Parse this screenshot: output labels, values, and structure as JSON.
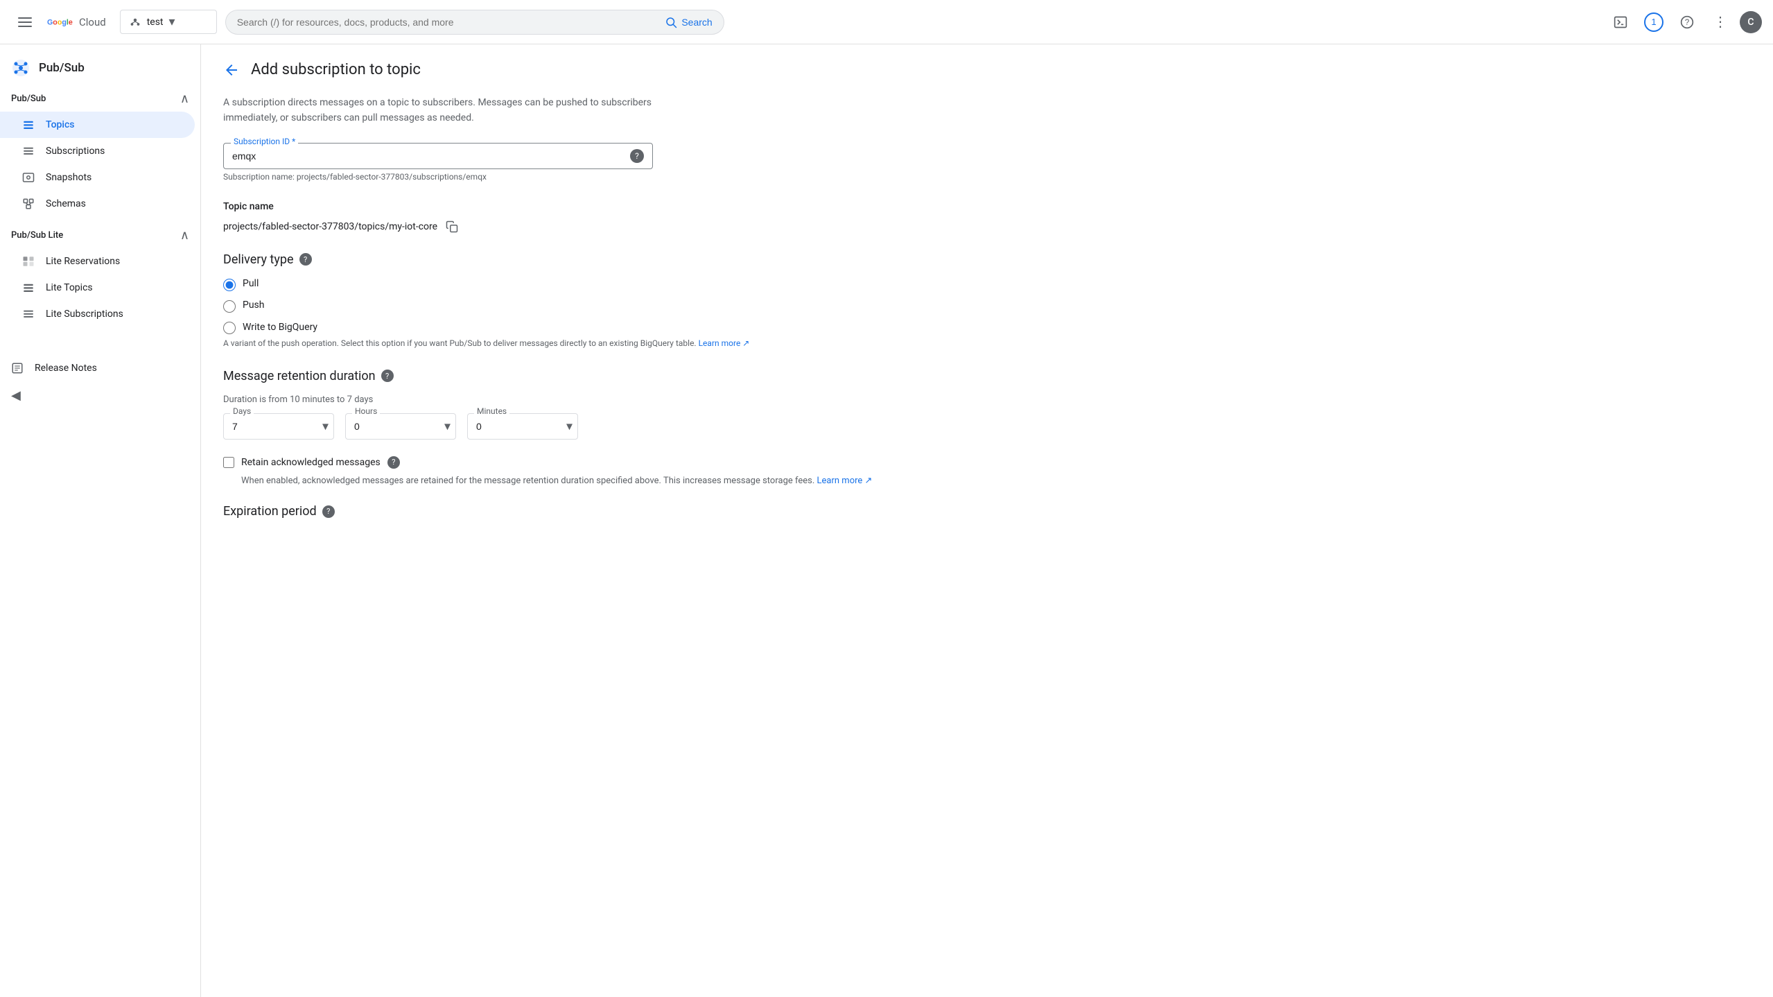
{
  "topbar": {
    "hamburger_label": "Menu",
    "logo_g": "G",
    "logo_cloud": "Cloud",
    "project_name": "test",
    "search_placeholder": "Search (/) for resources, docs, products, and more",
    "search_label": "Search",
    "notification_count": "1",
    "avatar_letter": "C"
  },
  "sidebar": {
    "service_title": "Pub/Sub",
    "pubsub_section": "Pub/Sub",
    "pubsub_lite_section": "Pub/Sub Lite",
    "items": [
      {
        "label": "Topics",
        "icon": "list-icon",
        "active": true
      },
      {
        "label": "Subscriptions",
        "icon": "list-rows-icon",
        "active": false
      },
      {
        "label": "Snapshots",
        "icon": "snapshot-icon",
        "active": false
      },
      {
        "label": "Schemas",
        "icon": "schema-icon",
        "active": false
      }
    ],
    "lite_items": [
      {
        "label": "Lite Reservations",
        "icon": "lite-res-icon",
        "active": false
      },
      {
        "label": "Lite Topics",
        "icon": "lite-topics-icon",
        "active": false
      },
      {
        "label": "Lite Subscriptions",
        "icon": "lite-sub-icon",
        "active": false
      }
    ],
    "release_notes": "Release Notes",
    "collapse_label": "Collapse"
  },
  "page": {
    "back_label": "Back",
    "title": "Add subscription to topic",
    "description": "A subscription directs messages on a topic to subscribers. Messages can be pushed to subscribers immediately, or subscribers can pull messages as needed.",
    "subscription_id_label": "Subscription ID *",
    "subscription_id_value": "emqx",
    "subscription_name_hint": "Subscription name: projects/fabled-sector-377803/subscriptions/emqx",
    "topic_name_label": "Topic name",
    "topic_name_value": "projects/fabled-sector-377803/topics/my-iot-core",
    "delivery_type_label": "Delivery type",
    "delivery_options": [
      {
        "label": "Pull",
        "checked": true
      },
      {
        "label": "Push",
        "checked": false
      },
      {
        "label": "Write to BigQuery",
        "checked": false
      }
    ],
    "write_bigquery_desc": "A variant of the push operation. Select this option if you want Pub/Sub to deliver messages directly to an existing BigQuery table.",
    "write_bigquery_link": "Learn more",
    "retention_label": "Message retention duration",
    "retention_duration_hint": "Duration is from 10 minutes to 7 days",
    "days_label": "Days",
    "days_value": "7",
    "hours_label": "Hours",
    "hours_value": "0",
    "minutes_label": "Minutes",
    "minutes_value": "0",
    "retain_ack_label": "Retain acknowledged messages",
    "retain_ack_desc": "When enabled, acknowledged messages are retained for the message retention duration specified above. This increases message storage fees.",
    "retain_ack_link": "Learn more",
    "expiration_label": "Expiration period",
    "copy_icon": "copy",
    "help_icon": "?"
  }
}
